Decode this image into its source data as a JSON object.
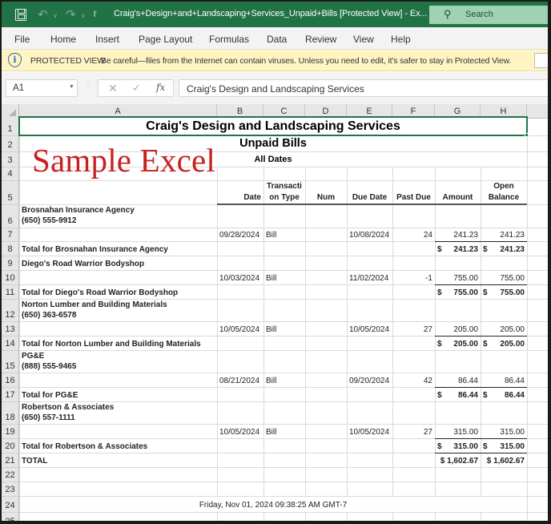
{
  "titlebar": {
    "title": "Craig's+Design+and+Landscaping+Services_Unpaid+Bills  [Protected View]  -  Ex...",
    "search_placeholder": "Search",
    "icons": [
      "save-icon",
      "undo-icon",
      "redo-icon",
      "customize-qat-icon",
      "search-icon"
    ]
  },
  "ribbon": {
    "tabs": [
      "File",
      "Home",
      "Insert",
      "Page Layout",
      "Formulas",
      "Data",
      "Review",
      "View",
      "Help"
    ]
  },
  "protected_view": {
    "label": "PROTECTED VIEW",
    "message": "Be careful—files from the Internet can contain viruses. Unless you need to edit, it's safer to stay in Protected View.",
    "icon": "info-shield-icon"
  },
  "formula_bar": {
    "name_box": "A1",
    "fx_label": "fx",
    "cancel_glyph": "✕",
    "enter_glyph": "✓",
    "value": "Craig's Design and Landscaping Services"
  },
  "sheet": {
    "columns": [
      "A",
      "B",
      "C",
      "D",
      "E",
      "F",
      "G",
      "H"
    ],
    "rows": [
      "1",
      "2",
      "3",
      "4",
      "5",
      "6",
      "7",
      "8",
      "9",
      "10",
      "11",
      "12",
      "13",
      "14",
      "15",
      "16",
      "17",
      "18",
      "19",
      "20",
      "21",
      "22",
      "23",
      "24",
      "25"
    ],
    "selected_cell": "A1",
    "watermark": "Sample Excel",
    "report": {
      "company": "Craig's Design and Landscaping Services",
      "title": "Unpaid Bills",
      "period": "All Dates",
      "headers": {
        "date": "Date",
        "transaction_type_1": "Transacti",
        "transaction_type_2": "on Type",
        "num": "Num",
        "due_date": "Due Date",
        "past_due": "Past Due",
        "amount": "Amount",
        "open_balance_1": "Open",
        "open_balance_2": "Balance"
      },
      "vendors": [
        {
          "name": "Brosnahan Insurance Agency",
          "phone": "(650) 555-9912",
          "bill": {
            "date": "09/28/2024",
            "type": "Bill",
            "num": "",
            "due_date": "10/08/2024",
            "past_due": "24",
            "amount": "241.23",
            "open_balance": "241.23"
          },
          "total_label": "Total for Brosnahan Insurance Agency",
          "total_amount": "241.23",
          "total_open_balance": "241.23"
        },
        {
          "name": "Diego's Road Warrior Bodyshop",
          "phone": "",
          "bill": {
            "date": "10/03/2024",
            "type": "Bill",
            "num": "",
            "due_date": "11/02/2024",
            "past_due": "-1",
            "amount": "755.00",
            "open_balance": "755.00"
          },
          "total_label": "Total for Diego's Road Warrior Bodyshop",
          "total_amount": "755.00",
          "total_open_balance": "755.00"
        },
        {
          "name": "Norton Lumber and Building Materials",
          "phone": "(650) 363-6578",
          "bill": {
            "date": "10/05/2024",
            "type": "Bill",
            "num": "",
            "due_date": "10/05/2024",
            "past_due": "27",
            "amount": "205.00",
            "open_balance": "205.00"
          },
          "total_label": "Total for Norton Lumber and Building Materials",
          "total_amount": "205.00",
          "total_open_balance": "205.00"
        },
        {
          "name": "PG&E",
          "phone": "(888) 555-9465",
          "bill": {
            "date": "08/21/2024",
            "type": "Bill",
            "num": "",
            "due_date": "09/20/2024",
            "past_due": "42",
            "amount": "86.44",
            "open_balance": "86.44"
          },
          "total_label": "Total for PG&E",
          "total_amount": "86.44",
          "total_open_balance": "86.44"
        },
        {
          "name": "Robertson & Associates",
          "phone": "(650) 557-1111",
          "bill": {
            "date": "10/05/2024",
            "type": "Bill",
            "num": "",
            "due_date": "10/05/2024",
            "past_due": "27",
            "amount": "315.00",
            "open_balance": "315.00"
          },
          "total_label": "Total for Robertson & Associates",
          "total_amount": "315.00",
          "total_open_balance": "315.00"
        }
      ],
      "currency_symbol": "$",
      "grand_total_label": "TOTAL",
      "grand_total_amount": "1,602.67",
      "grand_total_open_balance": "1,602.67",
      "footer_timestamp": "Friday, Nov 01, 2024 09:38:25 AM GMT-7"
    }
  }
}
